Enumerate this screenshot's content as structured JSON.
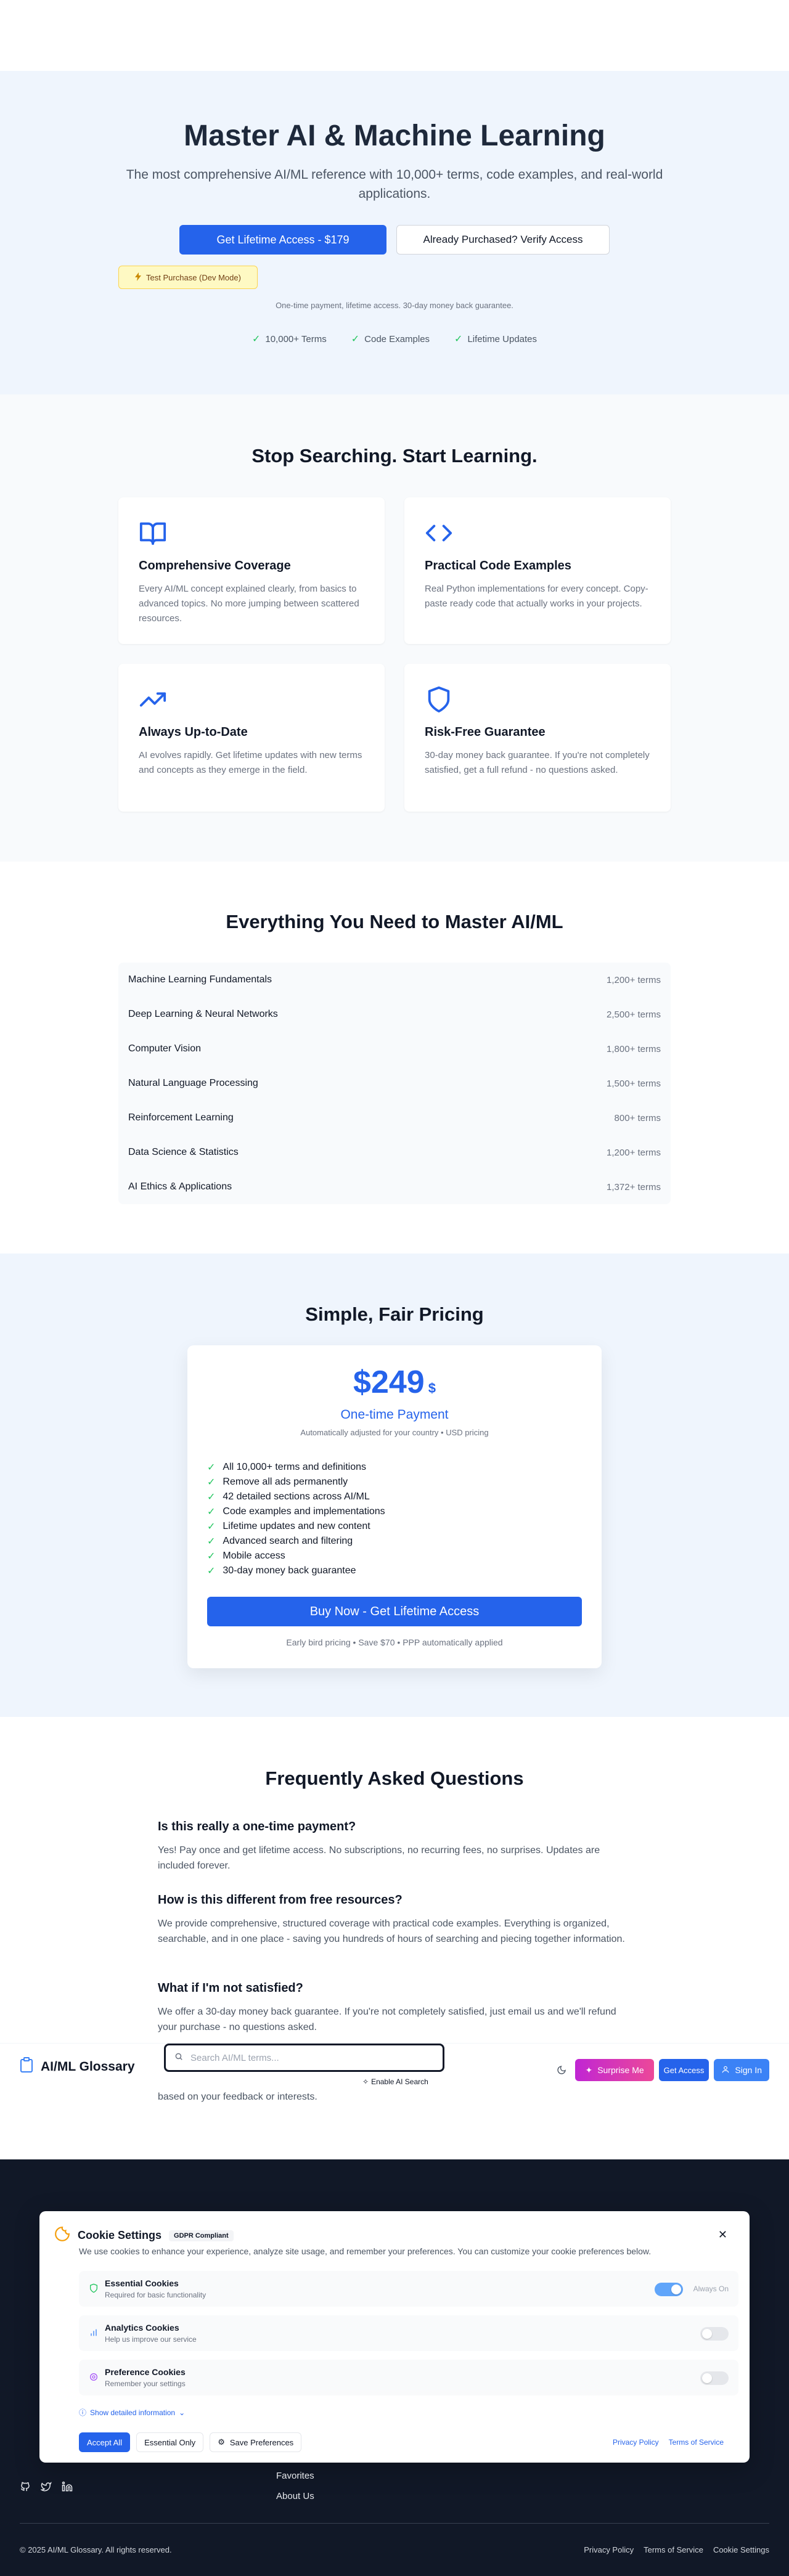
{
  "hero": {
    "title": "Master AI & Machine Learning",
    "subtitle": "The most comprehensive AI/ML reference with 10,000+ terms, code examples, and real-world applications.",
    "cta_primary": "Get Lifetime Access - $179",
    "cta_secondary": "Already Purchased? Verify Access",
    "dev_badge": "Test Purchase (Dev Mode)",
    "note": "One-time payment, lifetime access. 30-day money back guarantee.",
    "features": [
      "10,000+ Terms",
      "Code Examples",
      "Lifetime Updates"
    ]
  },
  "benefits": {
    "title": "Stop Searching. Start Learning.",
    "cards": [
      {
        "icon": "book-open-icon",
        "title": "Comprehensive Coverage",
        "desc": "Every AI/ML concept explained clearly, from basics to advanced topics. No more jumping between scattered resources."
      },
      {
        "icon": "code-icon",
        "title": "Practical Code Examples",
        "desc": "Real Python implementations for every concept. Copy-paste ready code that actually works in your projects."
      },
      {
        "icon": "trending-up-icon",
        "title": "Always Up-to-Date",
        "desc": "AI evolves rapidly. Get lifetime updates with new terms and concepts as they emerge in the field."
      },
      {
        "icon": "shield-icon",
        "title": "Risk-Free Guarantee",
        "desc": "30-day money back guarantee. If you're not completely satisfied, get a full refund - no questions asked."
      }
    ]
  },
  "topics": {
    "title": "Everything You Need to Master AI/ML",
    "rows": [
      {
        "name": "Machine Learning Fundamentals",
        "count": "1,200+ terms"
      },
      {
        "name": "Deep Learning & Neural Networks",
        "count": "2,500+ terms"
      },
      {
        "name": "Computer Vision",
        "count": "1,800+ terms"
      },
      {
        "name": "Natural Language Processing",
        "count": "1,500+ terms"
      },
      {
        "name": "Reinforcement Learning",
        "count": "800+ terms"
      },
      {
        "name": "Data Science & Statistics",
        "count": "1,200+ terms"
      },
      {
        "name": "AI Ethics & Applications",
        "count": "1,372+ terms"
      }
    ]
  },
  "pricing": {
    "title": "Simple, Fair Pricing",
    "price": "$249",
    "currency_symbol": "$",
    "subtitle": "One-time Payment",
    "note": "Automatically adjusted for your country • USD pricing",
    "features": [
      "All 10,000+ terms and definitions",
      "Remove all ads permanently",
      "42 detailed sections across AI/ML",
      "Code examples and implementations",
      "Lifetime updates and new content",
      "Advanced search and filtering",
      "Mobile access",
      "30-day money back guarantee"
    ],
    "cta": "Buy Now - Get Lifetime Access",
    "footnote": "Early bird pricing • Save $70 • PPP automatically applied"
  },
  "faq": {
    "title": "Frequently Asked Questions",
    "items": [
      {
        "q": "Is this really a one-time payment?",
        "a": "Yes! Pay once and get lifetime access. No subscriptions, no recurring fees, no surprises. Updates are included forever."
      },
      {
        "q": "How is this different from free resources?",
        "a": "We provide comprehensive, structured coverage with practical code examples. Everything is organized, searchable, and in one place - saving you hundreds of hours of searching and piecing together information."
      },
      {
        "q": "What if I'm not satisfied?",
        "a": "We offer a 30-day money back guarantee. If you're not completely satisfied, just email us and we'll refund your purchase - no questions asked."
      },
      {
        "q": "",
        "a": "based on your feedback or interests."
      }
    ]
  },
  "navbar": {
    "brand": "AI/ML Glossary",
    "search_placeholder": "Search AI/ML terms...",
    "ai_search": "Enable AI Search",
    "surprise": "Surprise Me",
    "get_access": "Get Access",
    "sign_in": "Sign In"
  },
  "cookie": {
    "title": "Cookie Settings",
    "badge": "GDPR Compliant",
    "description": "We use cookies to enhance your experience, analyze site usage, and remember your preferences. You can customize your cookie preferences below.",
    "rows": [
      {
        "name": "Essential Cookies",
        "desc": "Required for basic functionality",
        "enabled": true,
        "status": "Always On"
      },
      {
        "name": "Analytics Cookies",
        "desc": "Help us improve our service",
        "enabled": false
      },
      {
        "name": "Preference Cookies",
        "desc": "Remember your settings",
        "enabled": false
      }
    ],
    "details_link": "Show detailed information",
    "accept_all": "Accept All",
    "essential_only": "Essential Only",
    "save_preferences": "Save Preferences",
    "privacy_policy": "Privacy Policy",
    "terms_of_service": "Terms of Service"
  },
  "footer": {
    "links": [
      "Favorites",
      "About Us"
    ],
    "copyright": "© 2025 AI/ML Glossary. All rights reserved.",
    "legal": [
      "Privacy Policy",
      "Terms of Service",
      "Cookie Settings"
    ]
  },
  "colors": {
    "primary": "#2563eb",
    "hero_bg": "#eff5fd",
    "footer_bg": "#111827",
    "check": "#22c55e"
  }
}
